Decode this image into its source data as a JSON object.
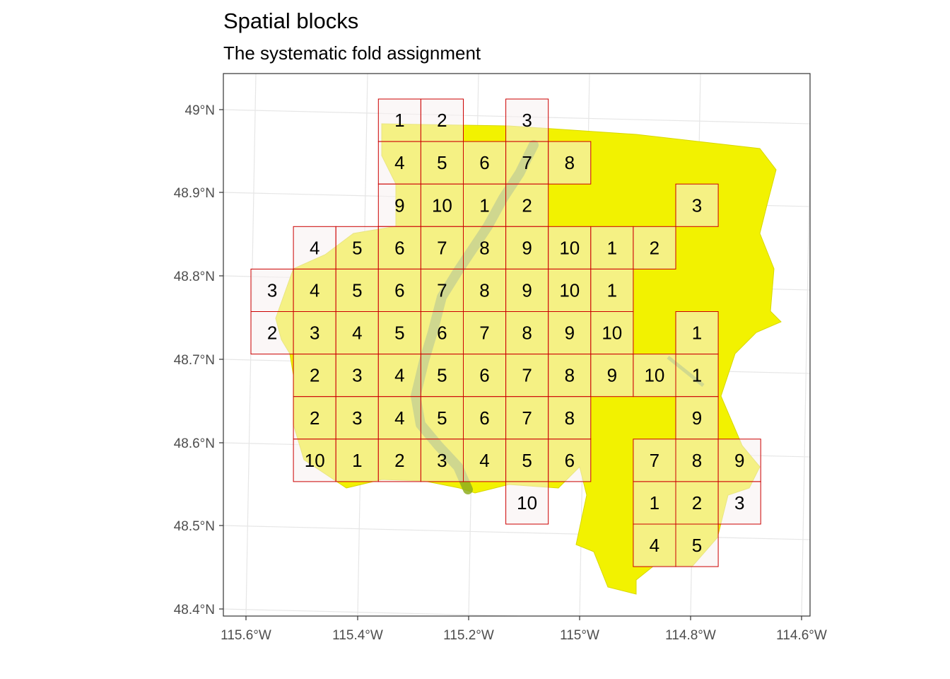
{
  "title": "Spatial blocks",
  "subtitle": "The systematic fold assignment",
  "axes": {
    "y_ticks": [
      "49°N",
      "48.9°N",
      "48.8°N",
      "48.7°N",
      "48.6°N",
      "48.5°N",
      "48.4°N"
    ],
    "x_ticks": [
      "115.6°W",
      "115.4°W",
      "115.2°W",
      "115°W",
      "114.8°W",
      "114.6°W"
    ]
  },
  "colors": {
    "raster": "#f2f200",
    "river": "#8fae1e",
    "block_stroke": "#cc0000",
    "block_fill": "#f7f0f0",
    "graticule": "#e6e6e6",
    "panel_border": "#333333"
  },
  "blocks": [
    {
      "row": 0,
      "col": 3,
      "fold": "1"
    },
    {
      "row": 0,
      "col": 4,
      "fold": "2"
    },
    {
      "row": 0,
      "col": 6,
      "fold": "3"
    },
    {
      "row": 1,
      "col": 3,
      "fold": "4"
    },
    {
      "row": 1,
      "col": 4,
      "fold": "5"
    },
    {
      "row": 1,
      "col": 5,
      "fold": "6"
    },
    {
      "row": 1,
      "col": 6,
      "fold": "7"
    },
    {
      "row": 1,
      "col": 7,
      "fold": "8"
    },
    {
      "row": 2,
      "col": 3,
      "fold": "9"
    },
    {
      "row": 2,
      "col": 4,
      "fold": "10"
    },
    {
      "row": 2,
      "col": 5,
      "fold": "1"
    },
    {
      "row": 2,
      "col": 6,
      "fold": "2"
    },
    {
      "row": 2,
      "col": 10,
      "fold": "3"
    },
    {
      "row": 3,
      "col": 1,
      "fold": "4"
    },
    {
      "row": 3,
      "col": 2,
      "fold": "5"
    },
    {
      "row": 3,
      "col": 3,
      "fold": "6"
    },
    {
      "row": 3,
      "col": 4,
      "fold": "7"
    },
    {
      "row": 3,
      "col": 5,
      "fold": "8"
    },
    {
      "row": 3,
      "col": 6,
      "fold": "9"
    },
    {
      "row": 3,
      "col": 7,
      "fold": "10"
    },
    {
      "row": 3,
      "col": 8,
      "fold": "1"
    },
    {
      "row": 3,
      "col": 9,
      "fold": "2"
    },
    {
      "row": 4,
      "col": 0,
      "fold": "3"
    },
    {
      "row": 4,
      "col": 1,
      "fold": "4"
    },
    {
      "row": 4,
      "col": 2,
      "fold": "5"
    },
    {
      "row": 4,
      "col": 3,
      "fold": "6"
    },
    {
      "row": 4,
      "col": 4,
      "fold": "7"
    },
    {
      "row": 4,
      "col": 5,
      "fold": "8"
    },
    {
      "row": 4,
      "col": 6,
      "fold": "9"
    },
    {
      "row": 4,
      "col": 7,
      "fold": "10"
    },
    {
      "row": 4,
      "col": 8,
      "fold": "1"
    },
    {
      "row": 5,
      "col": 0,
      "fold": "2"
    },
    {
      "row": 5,
      "col": 1,
      "fold": "3"
    },
    {
      "row": 5,
      "col": 2,
      "fold": "4"
    },
    {
      "row": 5,
      "col": 3,
      "fold": "5"
    },
    {
      "row": 5,
      "col": 4,
      "fold": "6"
    },
    {
      "row": 5,
      "col": 5,
      "fold": "7"
    },
    {
      "row": 5,
      "col": 6,
      "fold": "8"
    },
    {
      "row": 5,
      "col": 7,
      "fold": "9"
    },
    {
      "row": 5,
      "col": 8,
      "fold": "10"
    },
    {
      "row": 5,
      "col": 10,
      "fold": "1"
    },
    {
      "row": 6,
      "col": 1,
      "fold": "2"
    },
    {
      "row": 6,
      "col": 2,
      "fold": "3"
    },
    {
      "row": 6,
      "col": 3,
      "fold": "4"
    },
    {
      "row": 6,
      "col": 4,
      "fold": "5"
    },
    {
      "row": 6,
      "col": 5,
      "fold": "6"
    },
    {
      "row": 6,
      "col": 6,
      "fold": "7"
    },
    {
      "row": 6,
      "col": 7,
      "fold": "8"
    },
    {
      "row": 6,
      "col": 8,
      "fold": "9"
    },
    {
      "row": 6,
      "col": 9,
      "fold": "10"
    },
    {
      "row": 6,
      "col": 10,
      "fold": "1"
    },
    {
      "row": 7,
      "col": 1,
      "fold": "2"
    },
    {
      "row": 7,
      "col": 2,
      "fold": "3"
    },
    {
      "row": 7,
      "col": 3,
      "fold": "4"
    },
    {
      "row": 7,
      "col": 4,
      "fold": "5"
    },
    {
      "row": 7,
      "col": 5,
      "fold": "6"
    },
    {
      "row": 7,
      "col": 6,
      "fold": "7"
    },
    {
      "row": 7,
      "col": 7,
      "fold": "8"
    },
    {
      "row": 7,
      "col": 10,
      "fold": "9"
    },
    {
      "row": 8,
      "col": 1,
      "fold": "10"
    },
    {
      "row": 8,
      "col": 2,
      "fold": "1"
    },
    {
      "row": 8,
      "col": 3,
      "fold": "2"
    },
    {
      "row": 8,
      "col": 4,
      "fold": "3"
    },
    {
      "row": 8,
      "col": 5,
      "fold": "4"
    },
    {
      "row": 8,
      "col": 6,
      "fold": "5"
    },
    {
      "row": 8,
      "col": 7,
      "fold": "6"
    },
    {
      "row": 8,
      "col": 9,
      "fold": "7"
    },
    {
      "row": 8,
      "col": 10,
      "fold": "8"
    },
    {
      "row": 8,
      "col": 11,
      "fold": "9"
    },
    {
      "row": 9,
      "col": 6,
      "fold": "10"
    },
    {
      "row": 9,
      "col": 9,
      "fold": "1"
    },
    {
      "row": 9,
      "col": 10,
      "fold": "2"
    },
    {
      "row": 9,
      "col": 11,
      "fold": "3"
    },
    {
      "row": 10,
      "col": 9,
      "fold": "4"
    },
    {
      "row": 10,
      "col": 10,
      "fold": "5"
    }
  ]
}
